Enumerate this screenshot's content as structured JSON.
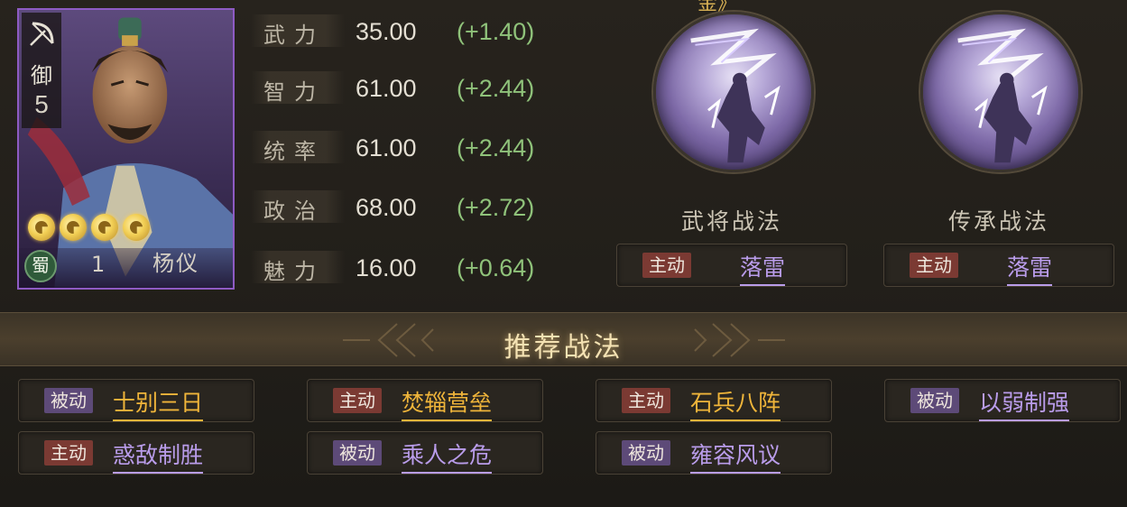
{
  "general": {
    "unit_type": "御",
    "cost": "5",
    "faction": "蜀",
    "level": "1",
    "name": "杨仪",
    "stars": 4
  },
  "stats": [
    {
      "label": "武力",
      "value": "35.00",
      "bonus": "(+1.40)"
    },
    {
      "label": "智力",
      "value": "61.00",
      "bonus": "(+2.44)"
    },
    {
      "label": "统率",
      "value": "61.00",
      "bonus": "(+2.44)"
    },
    {
      "label": "政治",
      "value": "68.00",
      "bonus": "(+2.72)"
    },
    {
      "label": "魅力",
      "value": "16.00",
      "bonus": "(+0.64)"
    }
  ],
  "skills": {
    "top_clipped_text": "金》",
    "own": {
      "title": "武将战法",
      "type": "主动",
      "name": "落雷"
    },
    "inherit": {
      "title": "传承战法",
      "type": "主动",
      "name": "落雷"
    }
  },
  "recommended": {
    "title": "推荐战法",
    "items": [
      {
        "type": "被动",
        "name": "士别三日",
        "style": "gold"
      },
      {
        "type": "主动",
        "name": "焚辎营垒",
        "style": "gold"
      },
      {
        "type": "主动",
        "name": "石兵八阵",
        "style": "gold"
      },
      {
        "type": "被动",
        "name": "以弱制强",
        "style": "purple"
      },
      {
        "type": "主动",
        "name": "惑敌制胜",
        "style": "purple"
      },
      {
        "type": "被动",
        "name": "乘人之危",
        "style": "purple"
      },
      {
        "type": "被动",
        "name": "雍容风议",
        "style": "purple"
      }
    ]
  },
  "colors": {
    "active_tag": "#7b3a33",
    "passive_tag": "#5d4a78",
    "gold_skill": "#f0b53a",
    "purple_skill": "#b99cea",
    "bonus_green": "#8fc27a",
    "card_border": "#8e5bc4"
  }
}
